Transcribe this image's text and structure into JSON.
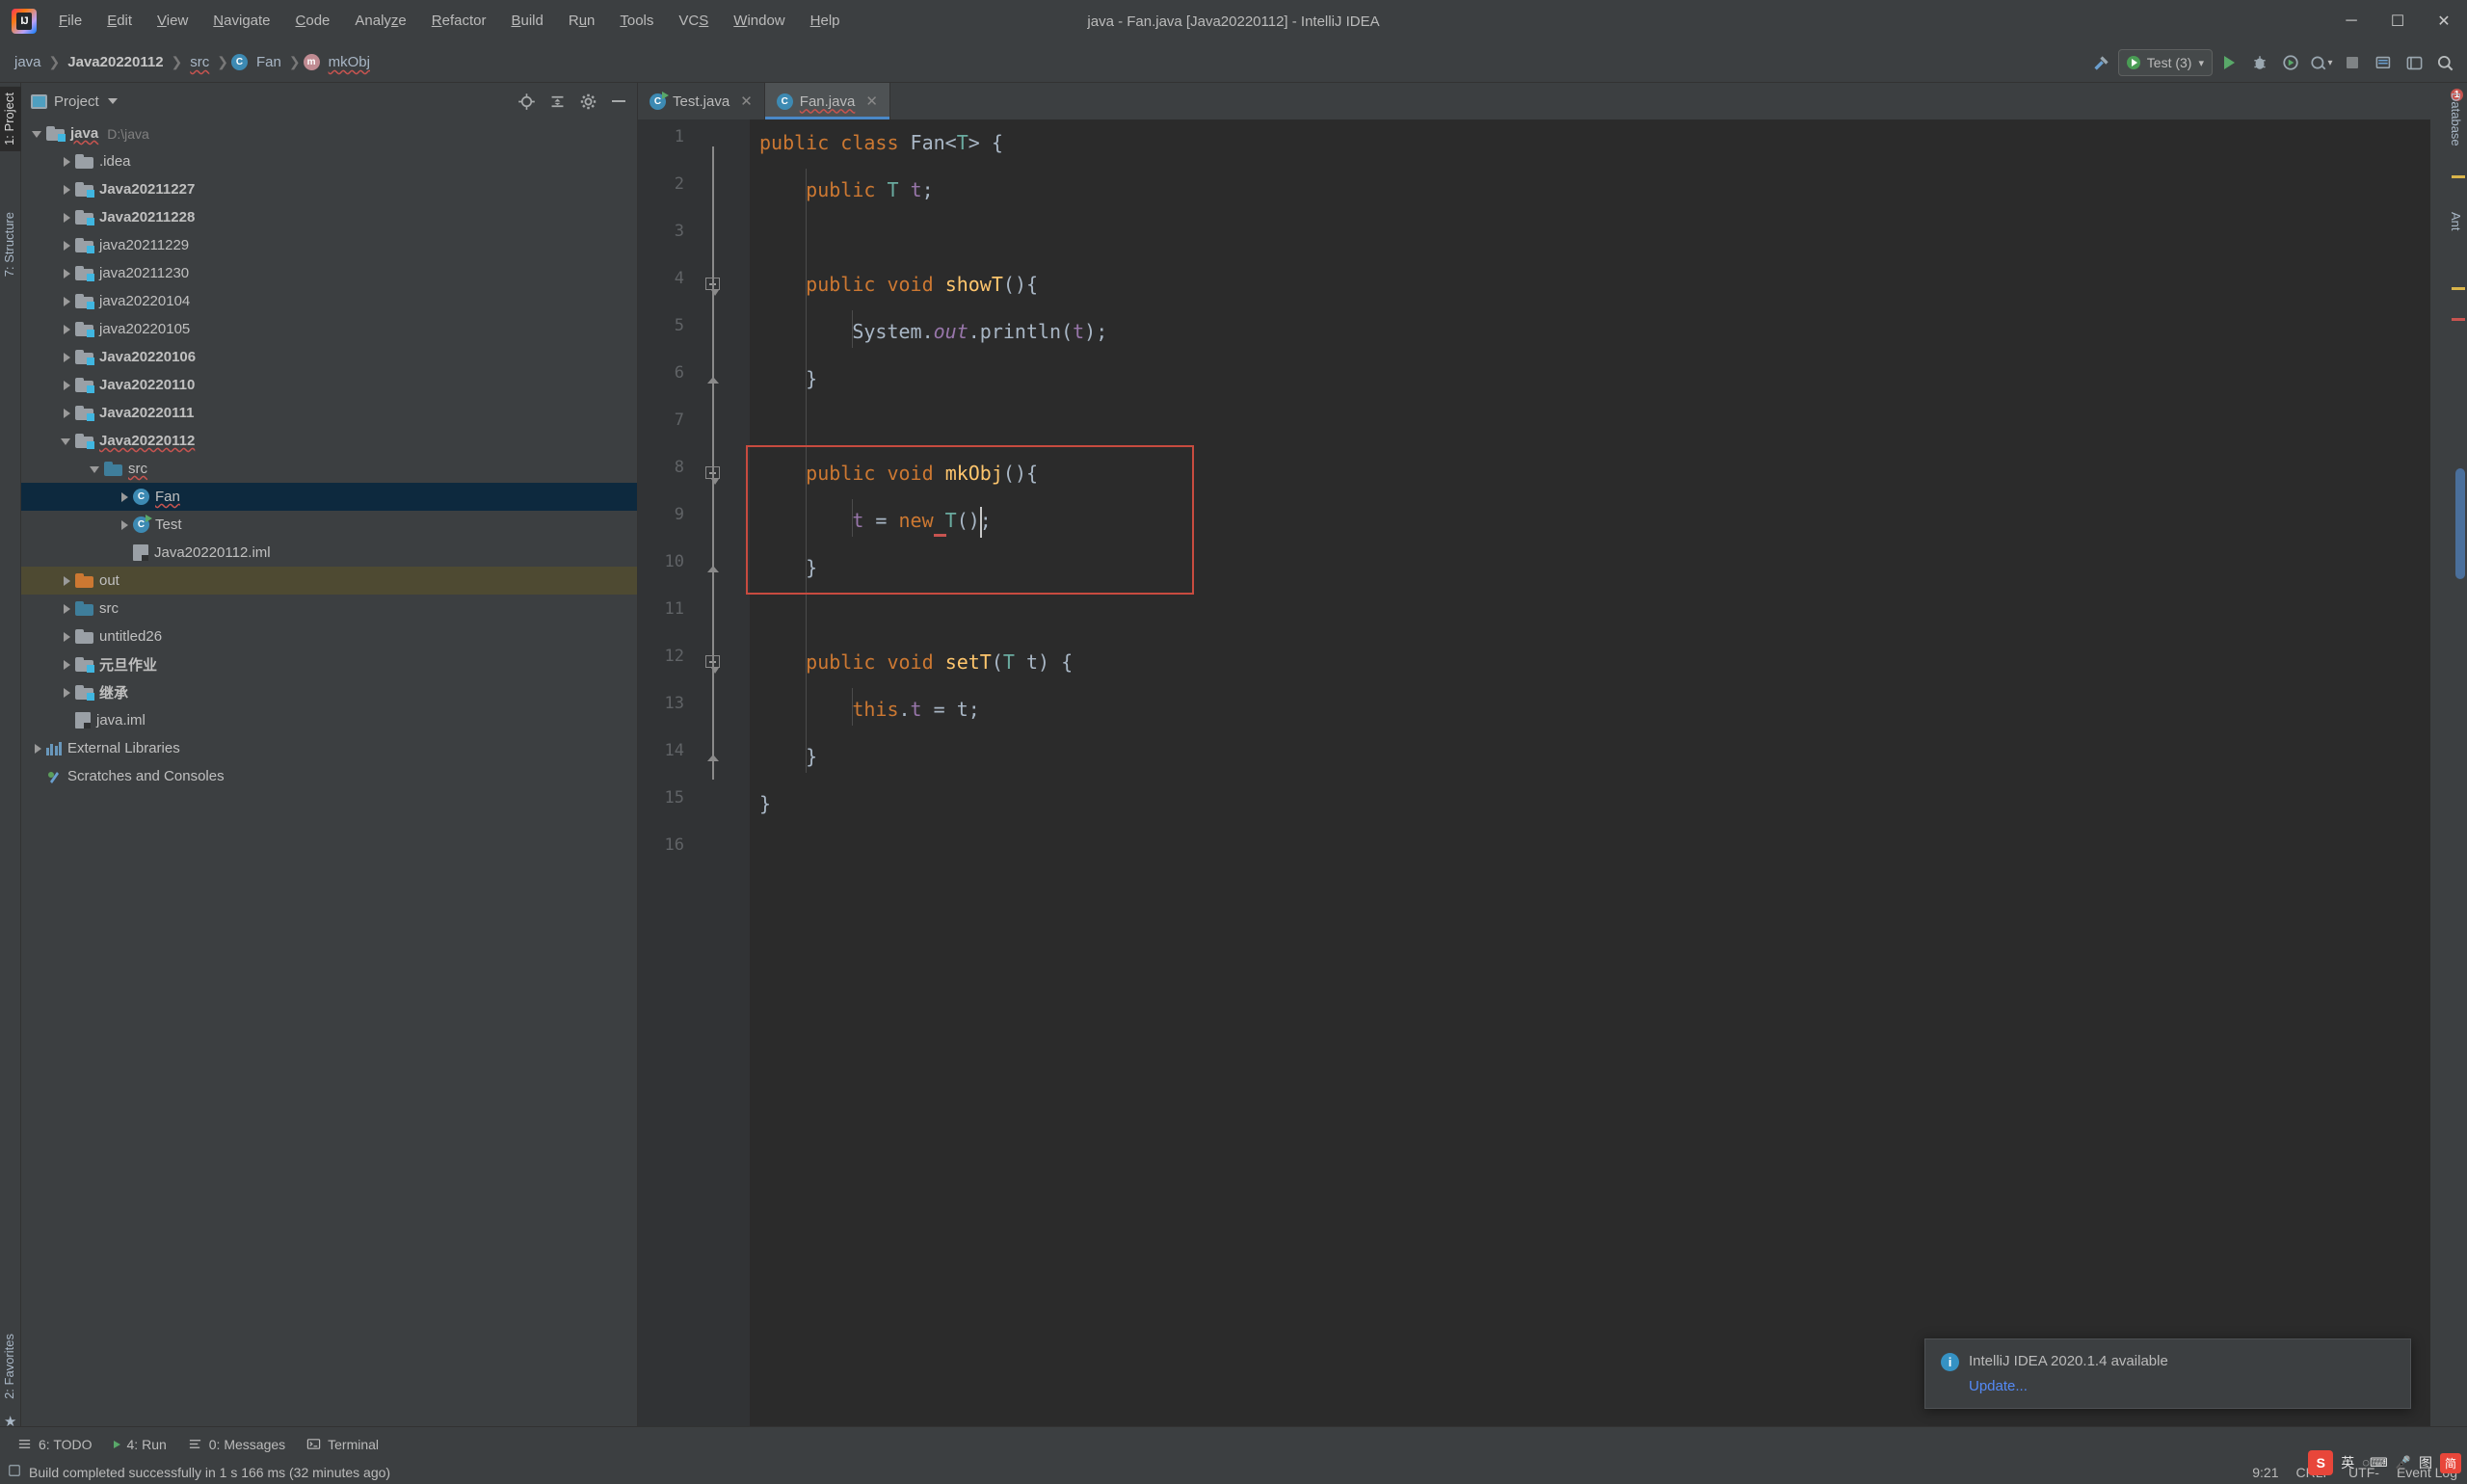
{
  "window": {
    "title": "java - Fan.java [Java20220112] - IntelliJ IDEA",
    "logo_letter": "IJ",
    "minimize": "─",
    "maximize": "☐",
    "close": "✕"
  },
  "menu": [
    {
      "label": "File",
      "mnemonic": "F"
    },
    {
      "label": "Edit",
      "mnemonic": "E"
    },
    {
      "label": "View",
      "mnemonic": "V"
    },
    {
      "label": "Navigate",
      "mnemonic": "N"
    },
    {
      "label": "Code",
      "mnemonic": "C"
    },
    {
      "label": "Analyze",
      "mnemonic": "z"
    },
    {
      "label": "Refactor",
      "mnemonic": "R"
    },
    {
      "label": "Build",
      "mnemonic": "B"
    },
    {
      "label": "Run",
      "mnemonic": "u"
    },
    {
      "label": "Tools",
      "mnemonic": "T"
    },
    {
      "label": "VCS",
      "mnemonic": "S"
    },
    {
      "label": "Window",
      "mnemonic": "W"
    },
    {
      "label": "Help",
      "mnemonic": "H"
    }
  ],
  "breadcrumb": [
    {
      "label": "java",
      "style": "plain"
    },
    {
      "label": "Java20220112",
      "style": "bold"
    },
    {
      "label": "src",
      "style": "wavy"
    },
    {
      "label": "Fan",
      "style": "plain",
      "icon": "class-icon",
      "icon_letter": "C"
    },
    {
      "label": "mkObj",
      "style": "wavy",
      "icon": "method-icon",
      "icon_letter": "m"
    }
  ],
  "toolbar": {
    "run_config": "Test (3)",
    "run_label": "run-button",
    "debug_label": "debug-button",
    "coverage_label": "coverage-button",
    "profile_label": "profile-button",
    "stop_label": "stop-button",
    "search_label": "search-everywhere",
    "build_label": "build-button"
  },
  "left_strip": [
    {
      "label": "1: Project",
      "active": true
    },
    {
      "label": "7: Structure",
      "active": false
    },
    {
      "label": "2: Favorites",
      "active": false
    }
  ],
  "right_strip": [
    {
      "label": "Database"
    },
    {
      "label": "Ant"
    }
  ],
  "project_panel": {
    "title": "Project",
    "tools": [
      "target-icon",
      "collapse-all-icon",
      "gear-icon",
      "hide-icon"
    ],
    "tree": [
      {
        "depth": 0,
        "arrow": "open",
        "icon": "folder-module",
        "label": "java",
        "bold": true,
        "wavy": true,
        "path": "D:\\java"
      },
      {
        "depth": 1,
        "arrow": "closed",
        "icon": "folder-grey",
        "label": ".idea"
      },
      {
        "depth": 1,
        "arrow": "closed",
        "icon": "folder-module",
        "label": "Java20211227",
        "bold": true
      },
      {
        "depth": 1,
        "arrow": "closed",
        "icon": "folder-module",
        "label": "Java20211228",
        "bold": true
      },
      {
        "depth": 1,
        "arrow": "closed",
        "icon": "folder-module",
        "label": "java20211229"
      },
      {
        "depth": 1,
        "arrow": "closed",
        "icon": "folder-module",
        "label": "java20211230"
      },
      {
        "depth": 1,
        "arrow": "closed",
        "icon": "folder-module",
        "label": "java20220104"
      },
      {
        "depth": 1,
        "arrow": "closed",
        "icon": "folder-module",
        "label": "java20220105"
      },
      {
        "depth": 1,
        "arrow": "closed",
        "icon": "folder-module",
        "label": "Java20220106",
        "bold": true
      },
      {
        "depth": 1,
        "arrow": "closed",
        "icon": "folder-module",
        "label": "Java20220110",
        "bold": true
      },
      {
        "depth": 1,
        "arrow": "closed",
        "icon": "folder-module",
        "label": "Java20220111",
        "bold": true
      },
      {
        "depth": 1,
        "arrow": "open",
        "icon": "folder-module",
        "label": "Java20220112",
        "bold": true,
        "wavy": true
      },
      {
        "depth": 2,
        "arrow": "open",
        "icon": "folder-source",
        "label": "src",
        "wavy": true
      },
      {
        "depth": 3,
        "arrow": "closed",
        "icon": "class-icon",
        "label": "Fan",
        "wavy": true,
        "selected": true
      },
      {
        "depth": 3,
        "arrow": "closed",
        "icon": "class-runnable",
        "label": "Test"
      },
      {
        "depth": 3,
        "arrow": "none",
        "icon": "iml-file",
        "label": "Java20220112.iml"
      },
      {
        "depth": 1,
        "arrow": "closed",
        "icon": "folder-out",
        "label": "out",
        "excluded": true
      },
      {
        "depth": 1,
        "arrow": "closed",
        "icon": "folder-source",
        "label": "src"
      },
      {
        "depth": 1,
        "arrow": "closed",
        "icon": "folder-grey",
        "label": "untitled26"
      },
      {
        "depth": 1,
        "arrow": "closed",
        "icon": "folder-module",
        "label": "元旦作业",
        "bold": true
      },
      {
        "depth": 1,
        "arrow": "closed",
        "icon": "folder-module",
        "label": "继承",
        "bold": true
      },
      {
        "depth": 1,
        "arrow": "none",
        "icon": "iml-file",
        "label": "java.iml"
      },
      {
        "depth": 0,
        "arrow": "closed",
        "icon": "library-icon",
        "label": "External Libraries"
      },
      {
        "depth": 0,
        "arrow": "none",
        "icon": "scratch-icon",
        "label": "Scratches and Consoles"
      }
    ]
  },
  "editor": {
    "tabs": [
      {
        "label": "Test.java",
        "icon_letter": "C",
        "active": false,
        "runnable": true
      },
      {
        "label": "Fan.java",
        "icon_letter": "C",
        "active": true,
        "wavy": true
      }
    ],
    "line_numbers": [
      "1",
      "2",
      "3",
      "4",
      "5",
      "6",
      "7",
      "8",
      "9",
      "10",
      "11",
      "12",
      "13",
      "14",
      "15",
      "16"
    ],
    "lines": [
      {
        "n": 1,
        "tokens": [
          {
            "t": "public ",
            "c": "kw"
          },
          {
            "t": "class ",
            "c": "kw"
          },
          {
            "t": "Fan",
            "c": "pln"
          },
          {
            "t": "<",
            "c": "pln"
          },
          {
            "t": "T",
            "c": "tprm"
          },
          {
            "t": "> {",
            "c": "pln"
          }
        ]
      },
      {
        "n": 2,
        "indent": 1,
        "tokens": [
          {
            "t": "public ",
            "c": "kw"
          },
          {
            "t": "T ",
            "c": "tprm"
          },
          {
            "t": "t",
            "c": "fld"
          },
          {
            "t": ";",
            "c": "pln"
          }
        ]
      },
      {
        "n": 3,
        "tokens": []
      },
      {
        "n": 4,
        "indent": 1,
        "tokens": [
          {
            "t": "public ",
            "c": "kw"
          },
          {
            "t": "void ",
            "c": "kw"
          },
          {
            "t": "showT",
            "c": "mth"
          },
          {
            "t": "(){",
            "c": "pln"
          }
        ]
      },
      {
        "n": 5,
        "indent": 2,
        "tokens": [
          {
            "t": "System",
            "c": "pln"
          },
          {
            "t": ".",
            "c": "pln"
          },
          {
            "t": "out",
            "c": "stat"
          },
          {
            "t": ".println(",
            "c": "pln"
          },
          {
            "t": "t",
            "c": "fld"
          },
          {
            "t": ");",
            "c": "pln"
          }
        ]
      },
      {
        "n": 6,
        "indent": 1,
        "tokens": [
          {
            "t": "}",
            "c": "pln"
          }
        ]
      },
      {
        "n": 7,
        "tokens": []
      },
      {
        "n": 8,
        "indent": 1,
        "tokens": [
          {
            "t": "public ",
            "c": "kw"
          },
          {
            "t": "void ",
            "c": "kw"
          },
          {
            "t": "mkObj",
            "c": "mth"
          },
          {
            "t": "(){",
            "c": "pln"
          }
        ]
      },
      {
        "n": 9,
        "indent": 2,
        "tokens": [
          {
            "t": "t",
            "c": "fld"
          },
          {
            "t": " = ",
            "c": "pln"
          },
          {
            "t": "new ",
            "c": "kw"
          },
          {
            "t": "T",
            "c": "tprm"
          },
          {
            "t": "();",
            "c": "pln"
          }
        ]
      },
      {
        "n": 10,
        "indent": 1,
        "tokens": [
          {
            "t": "}",
            "c": "pln"
          }
        ]
      },
      {
        "n": 11,
        "tokens": []
      },
      {
        "n": 12,
        "indent": 1,
        "tokens": [
          {
            "t": "public ",
            "c": "kw"
          },
          {
            "t": "void ",
            "c": "kw"
          },
          {
            "t": "setT",
            "c": "mth"
          },
          {
            "t": "(",
            "c": "pln"
          },
          {
            "t": "T",
            "c": "tprm"
          },
          {
            "t": " t) {",
            "c": "pln"
          }
        ]
      },
      {
        "n": 13,
        "indent": 2,
        "tokens": [
          {
            "t": "this",
            "c": "kw"
          },
          {
            "t": ".",
            "c": "pln"
          },
          {
            "t": "t",
            "c": "fld"
          },
          {
            "t": " = t;",
            "c": "pln"
          }
        ]
      },
      {
        "n": 14,
        "indent": 1,
        "tokens": [
          {
            "t": "}",
            "c": "pln"
          }
        ]
      },
      {
        "n": 15,
        "tokens": [
          {
            "t": "}",
            "c": "pln"
          }
        ]
      },
      {
        "n": 16,
        "tokens": []
      }
    ],
    "error_count": "1"
  },
  "notification": {
    "icon": "info-icon",
    "title": "IntelliJ IDEA 2020.1.4 available",
    "link": "Update..."
  },
  "bottom_tools": [
    {
      "label": "6: TODO",
      "mnemonic": "6",
      "icon": "todo-icon"
    },
    {
      "label": "4: Run",
      "mnemonic": "4",
      "icon": "run-icon"
    },
    {
      "label": "0: Messages",
      "mnemonic": "0",
      "icon": "messages-icon"
    },
    {
      "label": "Terminal",
      "mnemonic": "",
      "icon": "terminal-icon"
    }
  ],
  "status": {
    "message": "Build completed successfully in 1 s 166 ms (32 minutes ago)",
    "caret_position": "9:21",
    "line_separator": "CRLF",
    "encoding": "UTF-",
    "event_log": "Event Log"
  },
  "tray": {
    "ime_lang": "英",
    "ime_extra": "图",
    "sogou": "S",
    "badge": "简"
  },
  "colors": {
    "accent_blue": "#4a88c7",
    "selection": "#0d293e",
    "excluded": "#4e4a32",
    "keyword": "#cc7832",
    "method": "#ffc66d",
    "field": "#9876aa",
    "type_param": "#6aaba0",
    "plain": "#a9b7c6",
    "error_red": "#c84b3f",
    "editor_bg": "#2b2b2b",
    "panel_bg": "#3c3f41"
  }
}
